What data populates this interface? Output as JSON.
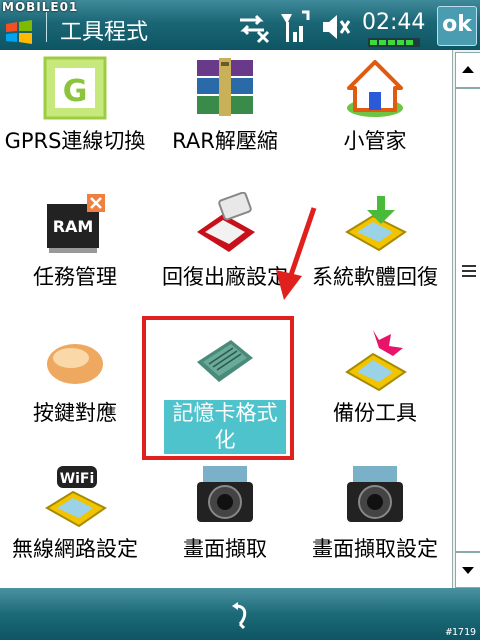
{
  "watermark": "MOBILE01",
  "title": "工具程式",
  "time": "02:44",
  "ok_label": "ok",
  "picture_id": "#1719",
  "colors": {
    "title_bar": "#1b6675",
    "selection": "#4fc3cc",
    "annotation": "#e0201d"
  },
  "items": [
    {
      "label": "GPRS連線切換",
      "icon": "gprs-icon"
    },
    {
      "label": "RAR解壓縮",
      "icon": "rar-icon"
    },
    {
      "label": "小管家",
      "icon": "home-icon"
    },
    {
      "label": "任務管理",
      "icon": "ram-icon"
    },
    {
      "label": "回復出廠設定",
      "icon": "factory-reset-icon"
    },
    {
      "label": "系統軟體回復",
      "icon": "system-restore-icon"
    },
    {
      "label": "按鍵對應",
      "icon": "button-map-icon"
    },
    {
      "label": "記憶卡格式化",
      "icon": "memory-card-icon",
      "selected": true
    },
    {
      "label": "備份工具",
      "icon": "backup-icon"
    },
    {
      "label": "無線網路設定",
      "icon": "wifi-icon"
    },
    {
      "label": "畫面擷取",
      "icon": "camera-icon"
    },
    {
      "label": "畫面擷取設定",
      "icon": "camera-settings-icon"
    }
  ]
}
